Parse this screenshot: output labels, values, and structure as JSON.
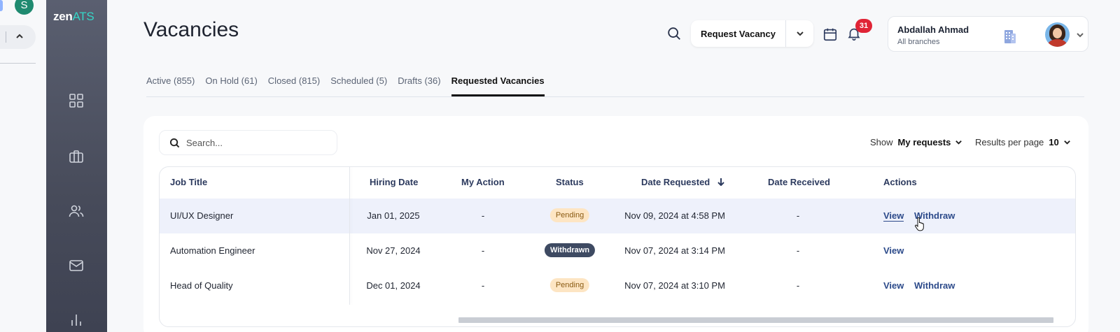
{
  "outer": {
    "avatar_letter": "S"
  },
  "brand": {
    "name_main": "zen",
    "name_accent": "ATS"
  },
  "header": {
    "title": "Vacancies",
    "request_button": "Request Vacancy",
    "notification_count": "31"
  },
  "user": {
    "name": "Abdallah Ahmad",
    "branches": "All branches"
  },
  "tabs": [
    {
      "label": "Active (855)",
      "active": false
    },
    {
      "label": "On Hold (61)",
      "active": false
    },
    {
      "label": "Closed (815)",
      "active": false
    },
    {
      "label": "Scheduled (5)",
      "active": false
    },
    {
      "label": "Drafts (36)",
      "active": false
    },
    {
      "label": "Requested Vacancies",
      "active": true
    }
  ],
  "toolbar": {
    "search_placeholder": "Search...",
    "show_label": "Show",
    "show_value": "My requests",
    "rpp_label": "Results per page",
    "rpp_value": "10"
  },
  "table": {
    "columns": {
      "job_title": "Job Title",
      "hiring_date": "Hiring Date",
      "my_action": "My Action",
      "status": "Status",
      "date_requested": "Date Requested",
      "date_received": "Date Received",
      "actions": "Actions"
    },
    "rows": [
      {
        "job_title": "UI/UX Designer",
        "hiring_date": "Jan 01, 2025",
        "my_action": "-",
        "status": "Pending",
        "date_requested": "Nov 09, 2024 at 4:58 PM",
        "date_received": "-",
        "view": "View",
        "withdraw": "Withdraw"
      },
      {
        "job_title": "Automation Engineer",
        "hiring_date": "Nov 27, 2024",
        "my_action": "-",
        "status": "Withdrawn",
        "date_requested": "Nov 07, 2024 at 3:14 PM",
        "date_received": "-",
        "view": "View",
        "withdraw": ""
      },
      {
        "job_title": "Head of Quality",
        "hiring_date": "Dec 01, 2024",
        "my_action": "-",
        "status": "Pending",
        "date_requested": "Nov 07, 2024 at 3:10 PM",
        "date_received": "-",
        "view": "View",
        "withdraw": "Withdraw"
      }
    ]
  },
  "colors": {
    "accent": "#35d6c7",
    "badge_red": "#e02436",
    "link": "#2c4a8a"
  }
}
